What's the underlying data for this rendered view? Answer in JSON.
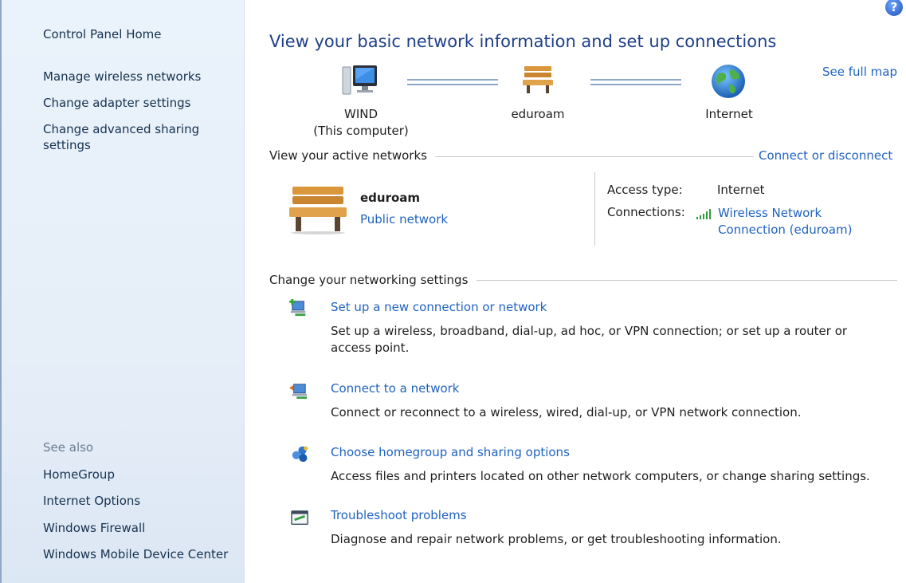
{
  "left": {
    "home": "Control Panel Home",
    "links": [
      "Manage wireless networks",
      "Change adapter settings",
      "Change advanced sharing settings"
    ],
    "see_also_title": "See also",
    "see_also": [
      "HomeGroup",
      "Internet Options",
      "Windows Firewall",
      "Windows Mobile Device Center"
    ]
  },
  "main": {
    "title": "View your basic network information and set up connections",
    "see_full_map": "See full map",
    "help_glyph": "?",
    "map": {
      "computer_name": "WIND",
      "computer_sub": "(This computer)",
      "network_name": "eduroam",
      "internet": "Internet"
    },
    "active_networks_heading": "View your active networks",
    "connect_disconnect": "Connect or disconnect",
    "active": {
      "name": "eduroam",
      "category": "Public network",
      "access_type_label": "Access type:",
      "access_type_value": "Internet",
      "connections_label": "Connections:",
      "connection_line1": "Wireless Network",
      "connection_line2": "Connection (eduroam)"
    },
    "change_heading": "Change your networking settings",
    "tasks": [
      {
        "title": "Set up a new connection or network",
        "desc": "Set up a wireless, broadband, dial-up, ad hoc, or VPN connection; or set up a router or access point.",
        "icon": "new-connection-icon"
      },
      {
        "title": "Connect to a network",
        "desc": "Connect or reconnect to a wireless, wired, dial-up, or VPN network connection.",
        "icon": "connect-network-icon"
      },
      {
        "title": "Choose homegroup and sharing options",
        "desc": "Access files and printers located on other network computers, or change sharing settings.",
        "icon": "homegroup-icon"
      },
      {
        "title": "Troubleshoot problems",
        "desc": "Diagnose and repair network problems, or get troubleshooting information.",
        "icon": "troubleshoot-icon"
      }
    ]
  },
  "colors": {
    "link": "#1f63c0",
    "title": "#1e3f8a",
    "pane": "#e6eef8"
  }
}
